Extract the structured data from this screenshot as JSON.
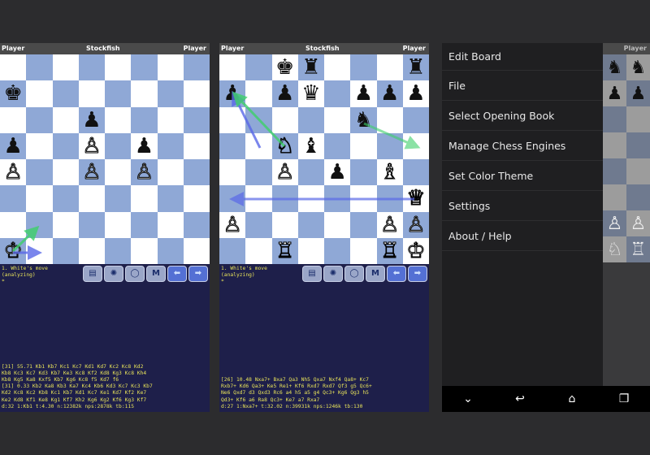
{
  "screen1": {
    "header": {
      "left": "Player",
      "center": "Stockfish",
      "right": "Player"
    },
    "board": [
      "........",
      "k.......",
      "...p....",
      "p..P.p..",
      "P..P.P..",
      "........",
      "........",
      "K......."
    ],
    "status": "1. White's move\n(analyzing)\n*",
    "pv": "[31] 55.71 Kb1 Kb7 Kc1 Kc7 Kd1 Kd7 Kc2 Kc8 Kd2\nKb8 Kc3 Kc7 Kd3 Kb7 Ke3 Kc8 Kf2 Kd8 Kg3 Kc8 Kh4\nKb8 Kg5 Ka8 Kxf5 Kb7 Kg6 Kc8 f5 Kd7 f6\n[31] 0.33 Kb2 Ka8 Kb3 Ka7 Kc4 Kb6 Kd3 Kc7 Kc3 Kb7\nKd2 Kc8 Kc2 Kb8 Kc1 Kb7 Kd1 Kc7 Ke1 Kd7 Kf2 Ke7\nKe2 Kd8 Kf1 Ke8 Kg1 Kf7 Kh2 Kg6 Kg2 Kf6 Kg3 Kf7\nd:32 1:Kb1 t:4.30 n:12382k nps:2878k tb:115"
  },
  "screen2": {
    "header": {
      "left": "Player",
      "center": "Stockfish",
      "right": "Player"
    },
    "board": [
      "..kr...r",
      "p.pq.ppp",
      ".....n..",
      "..Nb....",
      "..P.p.B.",
      ".......Q",
      "P.....PP",
      "..R...RK"
    ],
    "status": "1. White's move\n(analyzing)\n*",
    "pv": "[26] 10.48 Nxa7+ Bxa7 Qa3 Nh5 Qxa7 Nxf4 Qa8+ Kc7\nRxb7+ Kd6 Qa3+ Ke5 Re1+ Kf6 Rxd7 Rxd7 Qf3 g5 Qc6+\nNe6 Qxd7 d3 Qxd3 Rc6 a4 h5 a5 g4 Qc3+ Kg6 Qg3 h5\nQd3+ Kf6 a6 Ra8 Qc3+ Ke7 a7 Rxa7\nd:27 1:Nxa7+ t:32.02 n:39931k nps:1246k tb:130"
  },
  "toolbar": {
    "buttons": [
      "book-icon",
      "flash-icon",
      "circle-icon",
      "M",
      "left-arrow-icon",
      "right-arrow-icon"
    ],
    "m_label": "M"
  },
  "menu": {
    "items": [
      {
        "label": "Edit Board"
      },
      {
        "label": "File"
      },
      {
        "label": "Select Opening Book"
      },
      {
        "label": "Manage Chess Engines"
      },
      {
        "label": "Set Color Theme"
      },
      {
        "label": "Settings"
      },
      {
        "label": "About / Help"
      }
    ]
  },
  "peek": {
    "header": "Player"
  },
  "navbar": {
    "icons": [
      "hide-keyboard-icon",
      "back-icon",
      "home-icon",
      "recents-icon"
    ]
  },
  "colors": {
    "light_square": "#ffffff",
    "dark_square": "#8fa8d6",
    "info_bg": "#1e1f4a",
    "info_text": "#e8e35a",
    "menu_bg": "#1f1f21"
  }
}
